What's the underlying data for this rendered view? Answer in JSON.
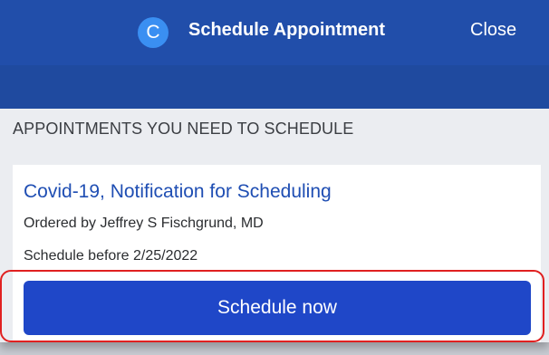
{
  "header": {
    "logo_letter": "C",
    "title": "Schedule Appointment",
    "close_label": "Close"
  },
  "section": {
    "heading": "APPOINTMENTS YOU NEED TO SCHEDULE"
  },
  "appointment": {
    "name": "Covid-19, Notification for Scheduling",
    "ordered_by": "Ordered by Jeffrey S Fischgrund, MD",
    "due": "Schedule before 2/25/2022",
    "button_label": "Schedule now"
  },
  "colors": {
    "header": "#214eaa",
    "link": "#1f4eb3",
    "button": "#1f47c8",
    "highlight": "#e02020"
  }
}
